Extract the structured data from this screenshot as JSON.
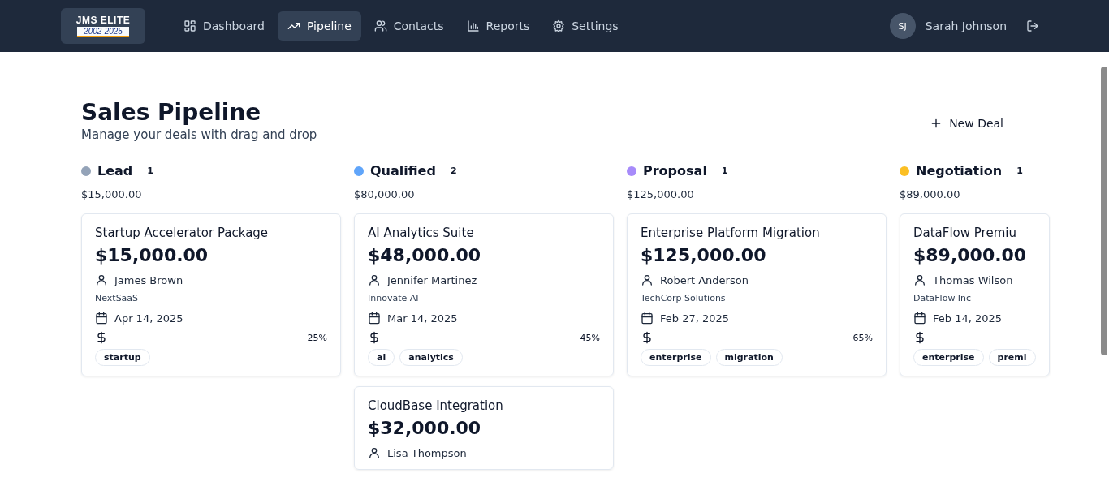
{
  "logo": {
    "title": "JMS ELITE",
    "years": "2002-2025"
  },
  "nav": [
    {
      "label": "Dashboard",
      "selected": false
    },
    {
      "label": "Pipeline",
      "selected": true
    },
    {
      "label": "Contacts",
      "selected": false
    },
    {
      "label": "Reports",
      "selected": false
    },
    {
      "label": "Settings",
      "selected": false
    }
  ],
  "user": {
    "initials": "SJ",
    "name": "Sarah Johnson"
  },
  "page": {
    "title": "Sales Pipeline",
    "subtitle": "Manage your deals with drag and drop",
    "new_button": "New Deal"
  },
  "columns": [
    {
      "name": "Lead",
      "count": "1",
      "total": "$15,000.00",
      "color": "#94a3b8",
      "deals": [
        {
          "title": "Startup Accelerator Package",
          "amount": "$15,000.00",
          "contact": "James Brown",
          "company": "NextSaaS",
          "date": "Apr 14, 2025",
          "probability": "25%",
          "tags": [
            "startup"
          ]
        }
      ]
    },
    {
      "name": "Qualified",
      "count": "2",
      "total": "$80,000.00",
      "color": "#60a5fa",
      "deals": [
        {
          "title": "AI Analytics Suite",
          "amount": "$48,000.00",
          "contact": "Jennifer Martinez",
          "company": "Innovate AI",
          "date": "Mar 14, 2025",
          "probability": "45%",
          "tags": [
            "ai",
            "analytics"
          ]
        },
        {
          "title": "CloudBase Integration",
          "amount": "$32,000.00",
          "contact": "Lisa Thompson"
        }
      ]
    },
    {
      "name": "Proposal",
      "count": "1",
      "total": "$125,000.00",
      "color": "#a78bfa",
      "deals": [
        {
          "title": "Enterprise Platform Migration",
          "amount": "$125,000.00",
          "contact": "Robert Anderson",
          "company": "TechCorp Solutions",
          "date": "Feb 27, 2025",
          "probability": "65%",
          "tags": [
            "enterprise",
            "migration"
          ]
        }
      ]
    },
    {
      "name": "Negotiation",
      "count": "1",
      "total": "$89,000.00",
      "color": "#fbbf24",
      "deals": [
        {
          "title": "DataFlow Premiu",
          "amount": "$89,000.00",
          "contact": "Thomas Wilson",
          "company": "DataFlow Inc",
          "date": "Feb 14, 2025",
          "tags": [
            "enterprise",
            "premi"
          ]
        }
      ]
    }
  ]
}
